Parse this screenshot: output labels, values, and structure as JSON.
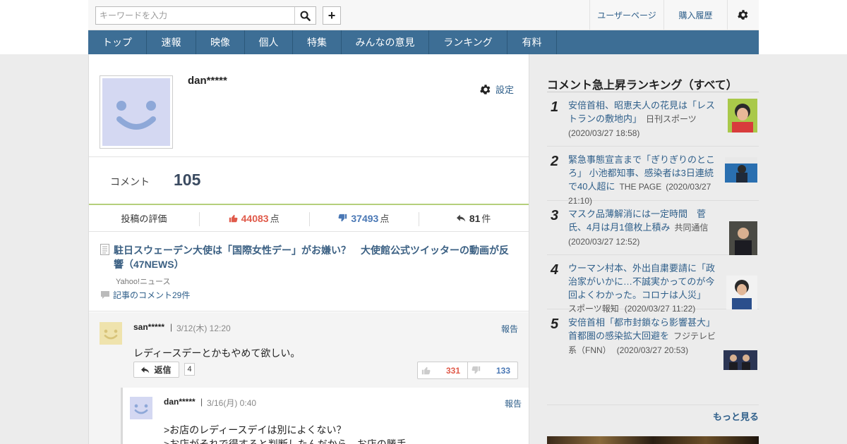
{
  "header": {
    "search_placeholder": "キーワードを入力",
    "user_page": "ユーザーページ",
    "purchase_history": "購入履歴"
  },
  "nav": [
    "トップ",
    "速報",
    "映像",
    "個人",
    "特集",
    "みんなの意見",
    "ランキング",
    "有料"
  ],
  "profile": {
    "name": "dan*****",
    "settings_label": "設定",
    "comment_label": "コメント",
    "comment_count": "105",
    "eval_label": "投稿の評価",
    "good_points": "44083",
    "bad_points": "37493",
    "points_unit": "点",
    "replies": "81",
    "replies_unit": "件"
  },
  "article": {
    "title": "駐日スウェーデン大使は「国際女性デー」がお嫌い？　大使館公式ツイッターの動画が反響（47NEWS）",
    "source": "Yahoo!ニュース",
    "comments_link": "記事のコメント29件"
  },
  "comments": [
    {
      "user": "san*****",
      "separator": "|",
      "date": "3/12(木) 12:20",
      "report": "報告",
      "text": "レディースデーとかもやめて欲しい。",
      "reply_label": "返信",
      "reply_count": "4",
      "good": "331",
      "bad": "133"
    },
    {
      "user": "dan*****",
      "separator": "|",
      "date": "3/16(月) 0:40",
      "report": "報告",
      "line1": ">お店のレディースデイは別によくない？",
      "line2": ">お店がそれで得すると判断したんだから、お店の勝手"
    }
  ],
  "ranking": {
    "title": "コメント急上昇ランキング（すべて）",
    "items": [
      {
        "num": "1",
        "title": "安倍首相、昭恵夫人の花見は「レストランの敷地内」",
        "source": "日刊スポーツ",
        "date": "(2020/03/27 18:58)"
      },
      {
        "num": "2",
        "title": "緊急事態宣言まで「ぎりぎりのところ」 小池都知事、感染者は3日連続で40人超に",
        "source": "THE PAGE",
        "date": "(2020/03/27 21:10)"
      },
      {
        "num": "3",
        "title": "マスク品薄解消には一定時間　菅氏、4月は月1億枚上積み",
        "source": "共同通信",
        "date": "(2020/03/27 12:52)"
      },
      {
        "num": "4",
        "title": "ウーマン村本、外出自粛要請に「政治家がいかに…不誠実かってのが今回よくわかった。コロナは人災」",
        "source": "スポーツ報知",
        "date": "(2020/03/27 11:22)"
      },
      {
        "num": "5",
        "title": "安倍首相「都市封鎖なら影響甚大」　首都圏の感染拡大回避を",
        "source": "フジテレビ系（FNN）",
        "date": "(2020/03/27 20:53)"
      }
    ],
    "more": "もっと見る"
  },
  "colors": {
    "nav_bg": "#3d6e95",
    "link": "#2f5f8a",
    "good": "#e05a4a",
    "bad": "#4a78b5",
    "accent_line": "#b5cf7b"
  }
}
